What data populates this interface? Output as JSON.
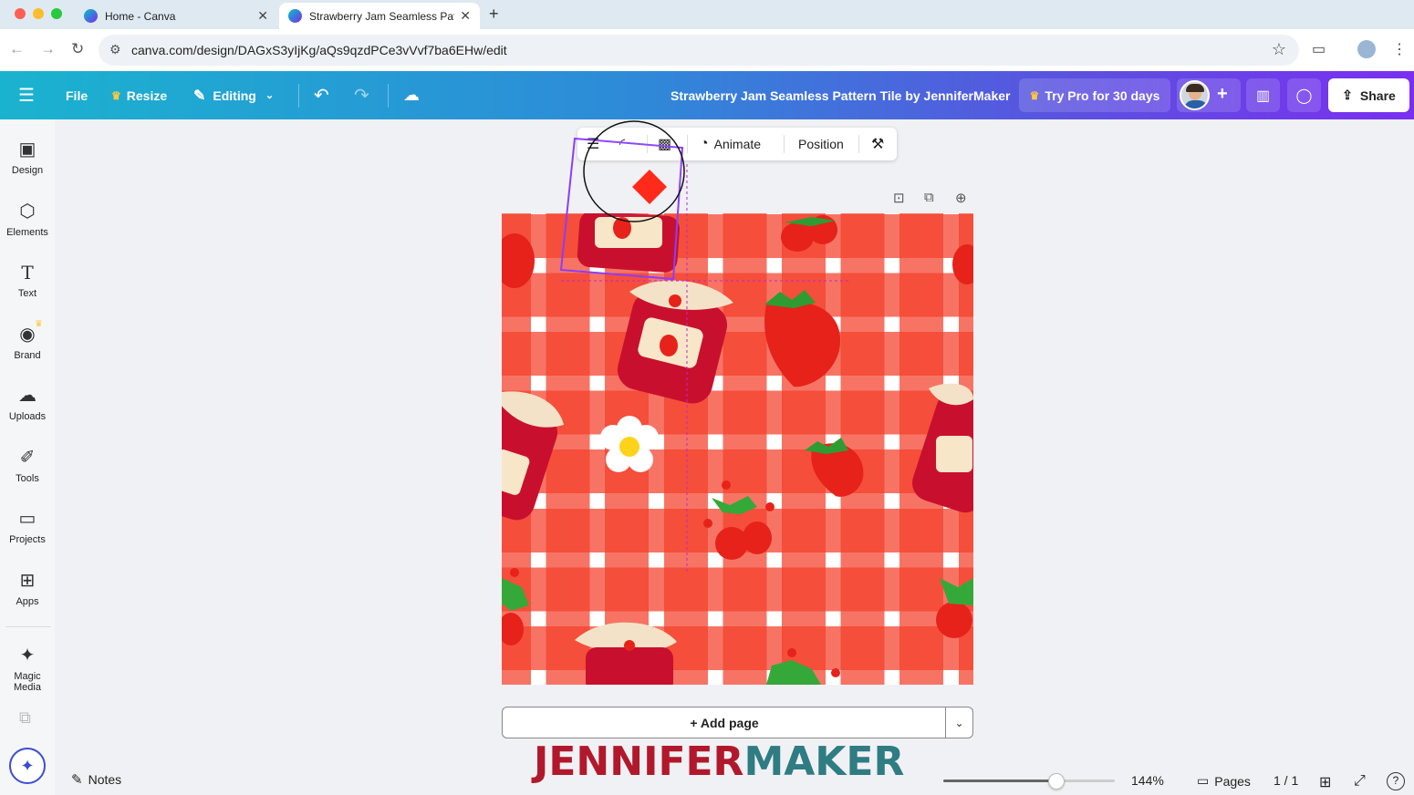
{
  "browser": {
    "tabs": [
      {
        "title": "Home - Canva",
        "active": false
      },
      {
        "title": "Strawberry Jam Seamless Pat",
        "active": true
      }
    ],
    "url": "canva.com/design/DAGxS3yIjKg/aQs9qzdPCe3vVvf7ba6EHw/edit"
  },
  "toolbar": {
    "file": "File",
    "resize": "Resize",
    "editing": "Editing",
    "design_title": "Strawberry Jam Seamless Pattern Tile by JenniferMaker",
    "try_pro": "Try Pro for 30 days",
    "share": "Share"
  },
  "sidebar": {
    "items": [
      {
        "label": "Design",
        "icon": "design-icon"
      },
      {
        "label": "Elements",
        "icon": "elements-icon"
      },
      {
        "label": "Text",
        "icon": "text-icon"
      },
      {
        "label": "Brand",
        "icon": "brand-icon"
      },
      {
        "label": "Uploads",
        "icon": "uploads-icon"
      },
      {
        "label": "Tools",
        "icon": "tools-icon"
      },
      {
        "label": "Projects",
        "icon": "projects-icon"
      },
      {
        "label": "Apps",
        "icon": "apps-icon"
      },
      {
        "label": "Magic Media",
        "icon": "magic-media-icon"
      }
    ]
  },
  "context_toolbar": {
    "animate": "Animate",
    "position": "Position"
  },
  "canvas": {
    "add_page": "+ Add page"
  },
  "footer": {
    "notes": "Notes",
    "zoom_level": "144%",
    "zoom_fraction": 0.66,
    "pages_label": "Pages",
    "page_count": "1 / 1"
  },
  "watermark": {
    "part1": "JENNIFER",
    "part2": "MAKER"
  },
  "colors": {
    "gingham_red": "#f43f29",
    "jam_red": "#c8102e",
    "watermark_red": "#b2182b",
    "watermark_teal": "#2f7c83",
    "selection_purple": "#8b3dff"
  }
}
